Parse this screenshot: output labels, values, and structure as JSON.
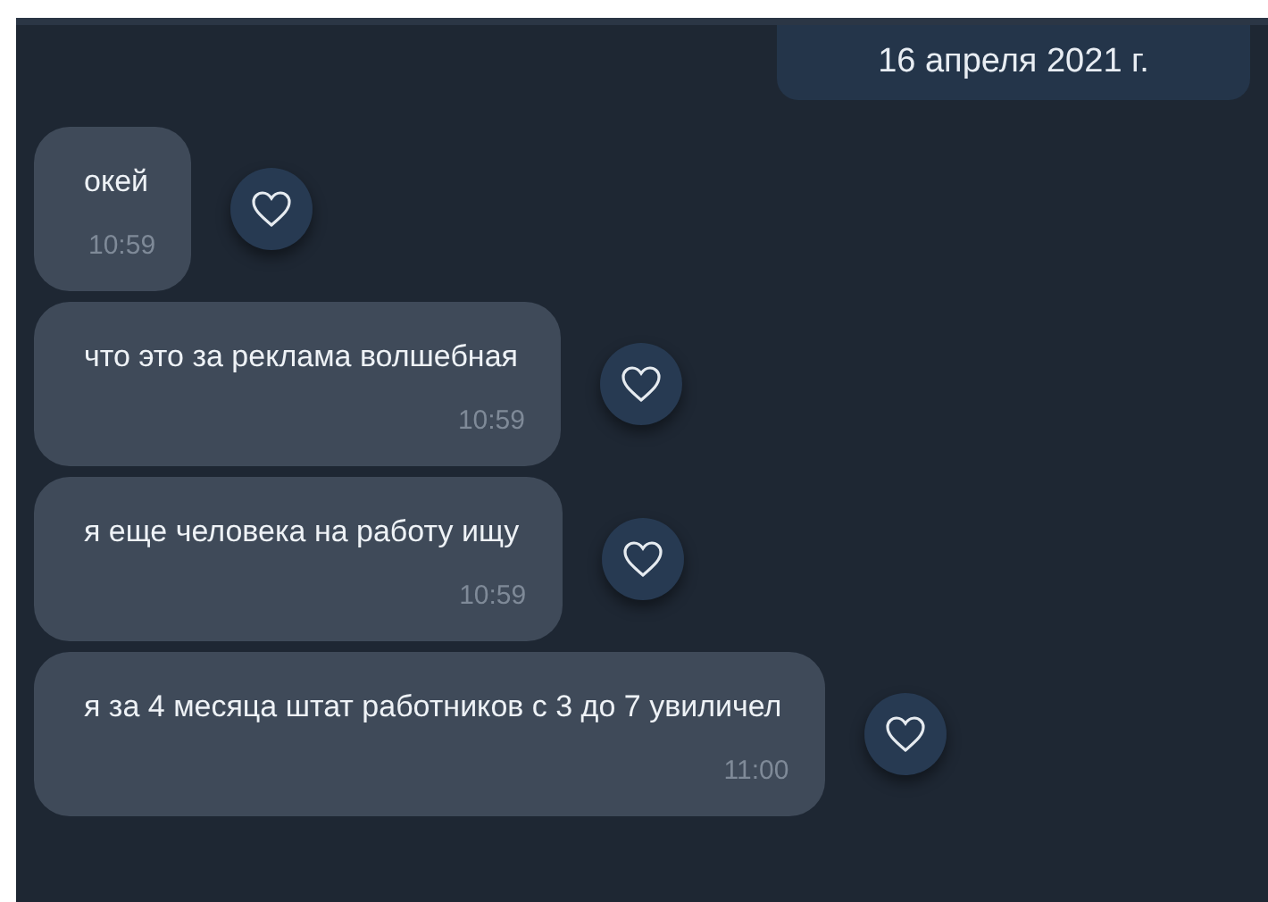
{
  "date_badge": "16 апреля 2021 г.",
  "messages": [
    {
      "text": "окей",
      "time": "10:59"
    },
    {
      "text": "что это за реклама волшебная",
      "time": "10:59"
    },
    {
      "text": "я еще человека на работу ищу",
      "time": "10:59"
    },
    {
      "text": "я за 4 месяца штат работников с 3 до 7 увиличел",
      "time": "11:00"
    }
  ]
}
